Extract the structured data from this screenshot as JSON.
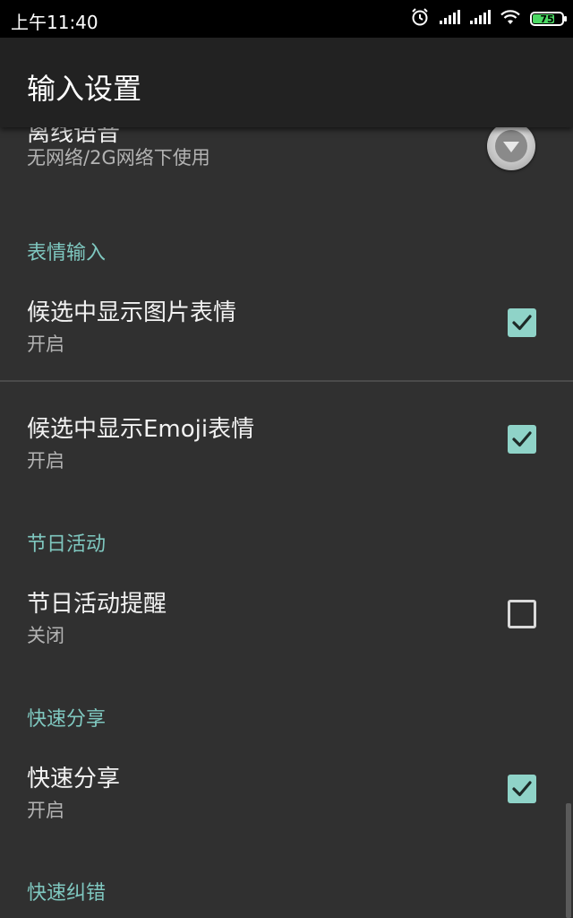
{
  "status_bar": {
    "time": "上午11:40",
    "battery": "75",
    "icons": [
      "alarm-icon",
      "signal-icon",
      "signal-icon",
      "wifi-icon",
      "battery-icon"
    ]
  },
  "app_bar": {
    "title": "输入设置"
  },
  "items": {
    "offline_voice": {
      "title": "离线语音",
      "subtitle": "无网络/2G网络下使用"
    },
    "image_emoticon": {
      "title": "候选中显示图片表情",
      "subtitle": "开启",
      "checked": true
    },
    "emoji": {
      "title": "候选中显示Emoji表情",
      "subtitle": "开启",
      "checked": true
    },
    "holiday_reminder": {
      "title": "节日活动提醒",
      "subtitle": "关闭",
      "checked": false
    },
    "quick_share": {
      "title": "快速分享",
      "subtitle": "开启",
      "checked": true
    }
  },
  "sections": {
    "emoticon_input": "表情输入",
    "holiday": "节日活动",
    "quick_share": "快速分享",
    "quick_correction": "快速纠错"
  },
  "colors": {
    "accent": "#7fc8c0",
    "checkbox_on": "#8fd3c8",
    "background": "#303030",
    "app_bar": "#222222"
  }
}
